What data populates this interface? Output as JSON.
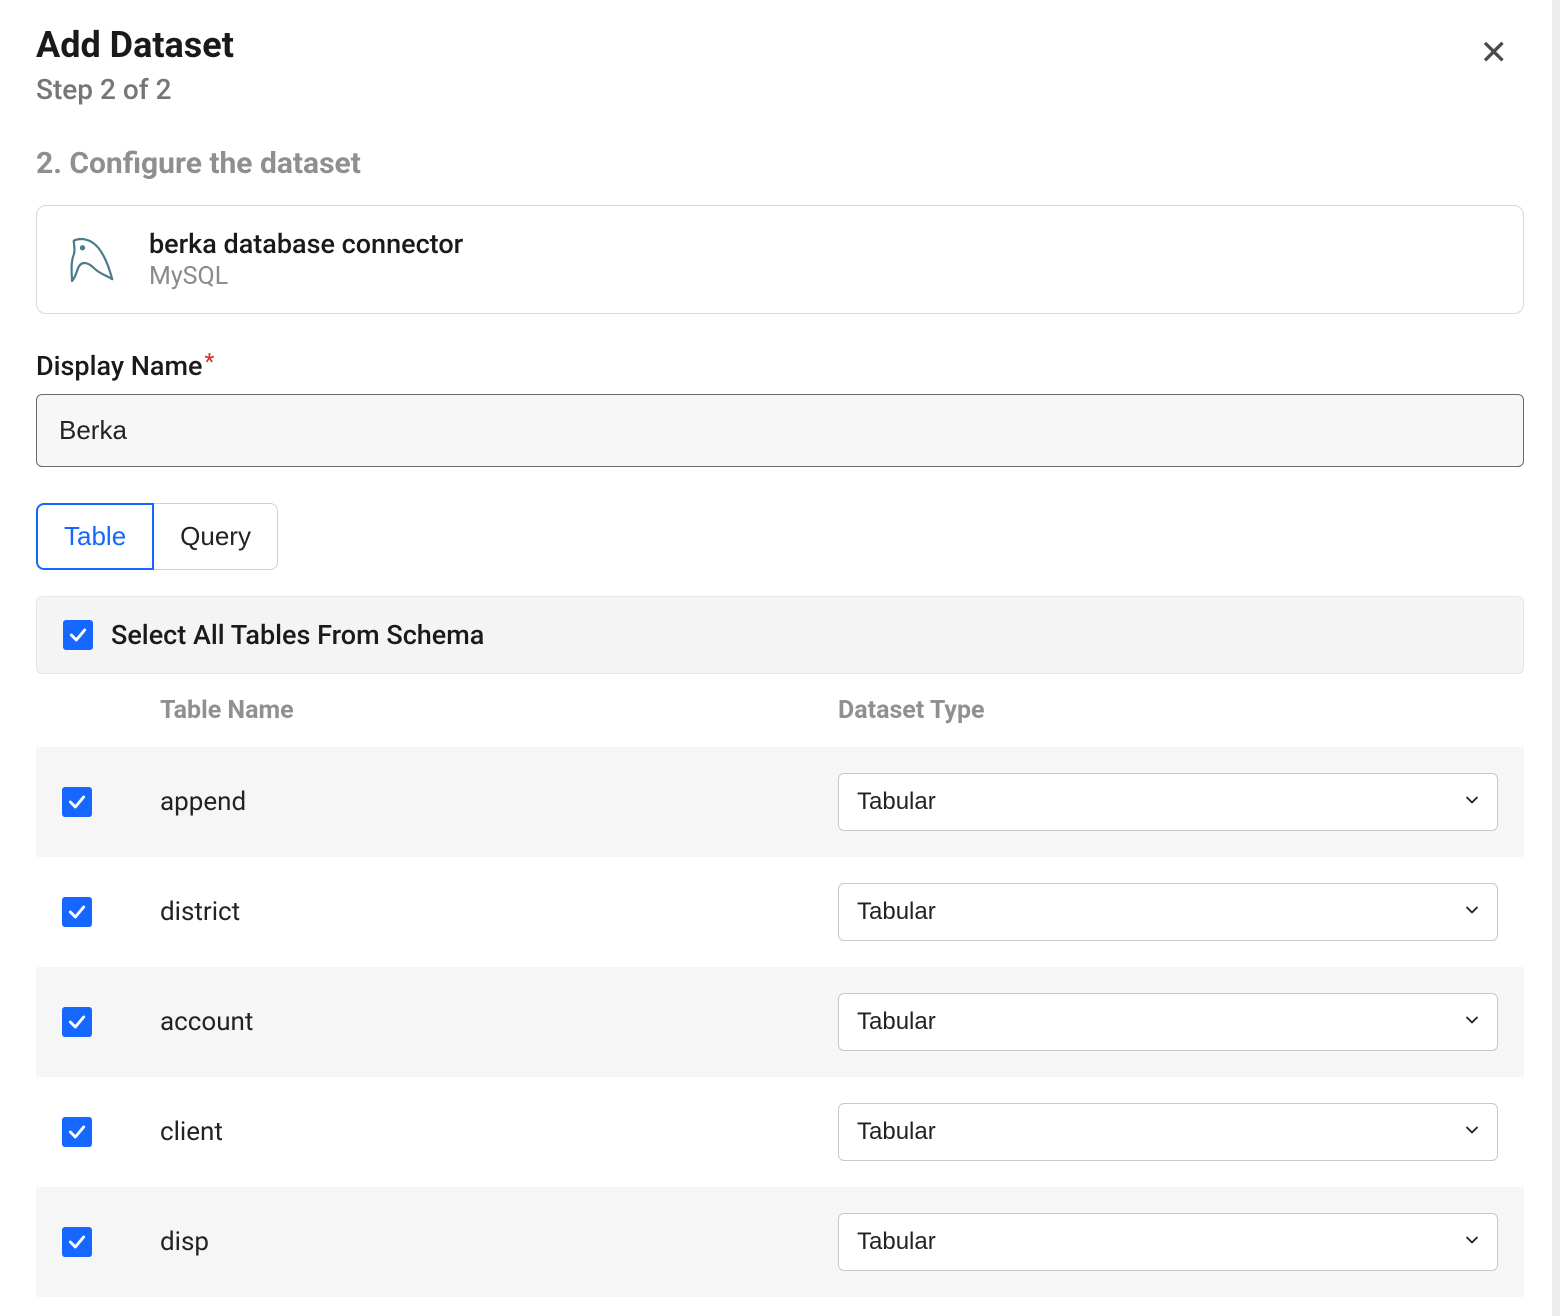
{
  "header": {
    "title": "Add Dataset",
    "step": "Step 2 of 2"
  },
  "section_title": "2. Configure the dataset",
  "connector": {
    "name": "berka database connector",
    "type": "MySQL"
  },
  "display_name": {
    "label": "Display Name",
    "value": "Berka"
  },
  "tabs": {
    "table": "Table",
    "query": "Query"
  },
  "select_all_label": "Select All Tables From Schema",
  "columns": {
    "table_name": "Table Name",
    "dataset_type": "Dataset Type"
  },
  "dataset_type_value": "Tabular",
  "rows": [
    {
      "name": "append",
      "type": "Tabular"
    },
    {
      "name": "district",
      "type": "Tabular"
    },
    {
      "name": "account",
      "type": "Tabular"
    },
    {
      "name": "client",
      "type": "Tabular"
    },
    {
      "name": "disp",
      "type": "Tabular"
    }
  ]
}
